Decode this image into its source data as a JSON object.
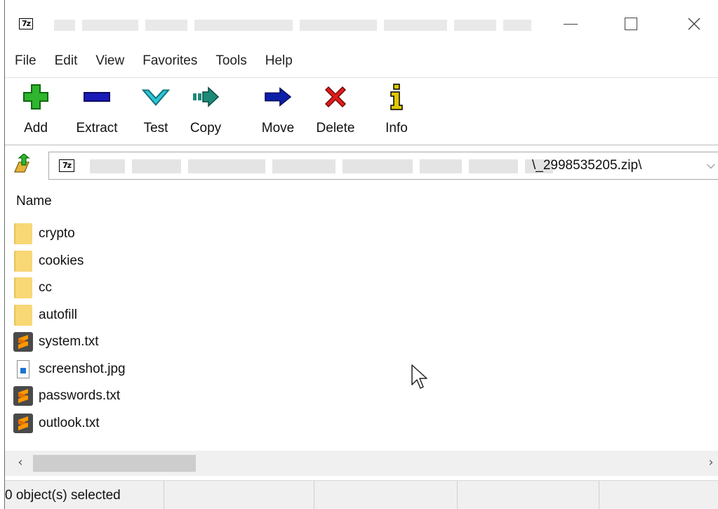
{
  "titlebar": {
    "app_icon": "7z-icon",
    "minimize": "minimize-icon",
    "maximize": "maximize-icon",
    "close": "close-icon"
  },
  "menu": [
    "File",
    "Edit",
    "View",
    "Favorites",
    "Tools",
    "Help"
  ],
  "toolbar": {
    "buttons": [
      {
        "label": "Add",
        "icon": "plus-icon",
        "color": "#2fb52f"
      },
      {
        "label": "Extract",
        "icon": "minus-icon",
        "color": "#1a1ab8"
      },
      {
        "label": "Test",
        "icon": "checkmark-icon",
        "color": "#2ec6d6"
      },
      {
        "label": "Copy",
        "icon": "copy-arrow-icon",
        "color": "#1d8a78"
      },
      {
        "label": "Move",
        "icon": "move-arrow-icon",
        "color": "#0c1fa8"
      },
      {
        "label": "Delete",
        "icon": "delete-x-icon",
        "color": "#e01b1b"
      },
      {
        "label": "Info",
        "icon": "info-icon",
        "color": "#e0c800"
      }
    ]
  },
  "address": {
    "path_tail": "\\_2998535205.zip\\",
    "up_icon": "folder-up-icon",
    "dropdown_icon": "chevron-down-icon"
  },
  "list": {
    "column_name": "Name",
    "items": [
      {
        "name": "crypto",
        "type": "folder"
      },
      {
        "name": "cookies",
        "type": "folder"
      },
      {
        "name": "cc",
        "type": "folder"
      },
      {
        "name": "autofill",
        "type": "folder"
      },
      {
        "name": "system.txt",
        "type": "txt"
      },
      {
        "name": "screenshot.jpg",
        "type": "jpg"
      },
      {
        "name": "passwords.txt",
        "type": "txt"
      },
      {
        "name": "outlook.txt",
        "type": "txt"
      }
    ]
  },
  "status": {
    "selected": "0 object(s) selected"
  }
}
